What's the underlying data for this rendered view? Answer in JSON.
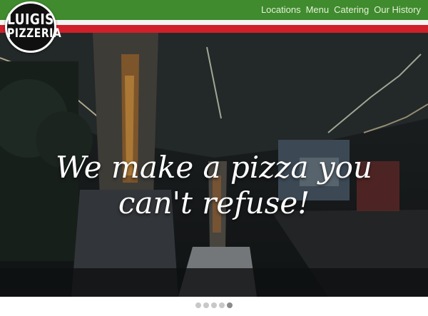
{
  "brand": {
    "logo_top": "LUIGIS",
    "logo_bottom": "PIZZERIA"
  },
  "nav": {
    "items": [
      {
        "label": "Locations"
      },
      {
        "label": "Menu"
      },
      {
        "label": "Catering"
      },
      {
        "label": "Our History"
      }
    ]
  },
  "hero": {
    "tagline_line1": "We make a pizza you",
    "tagline_line2": "can't refuse!"
  },
  "carousel": {
    "slide_count": 5,
    "active_index": 4
  },
  "colors": {
    "green": "#3f8b2e",
    "white": "#f4f4f4",
    "red": "#d0202a"
  }
}
